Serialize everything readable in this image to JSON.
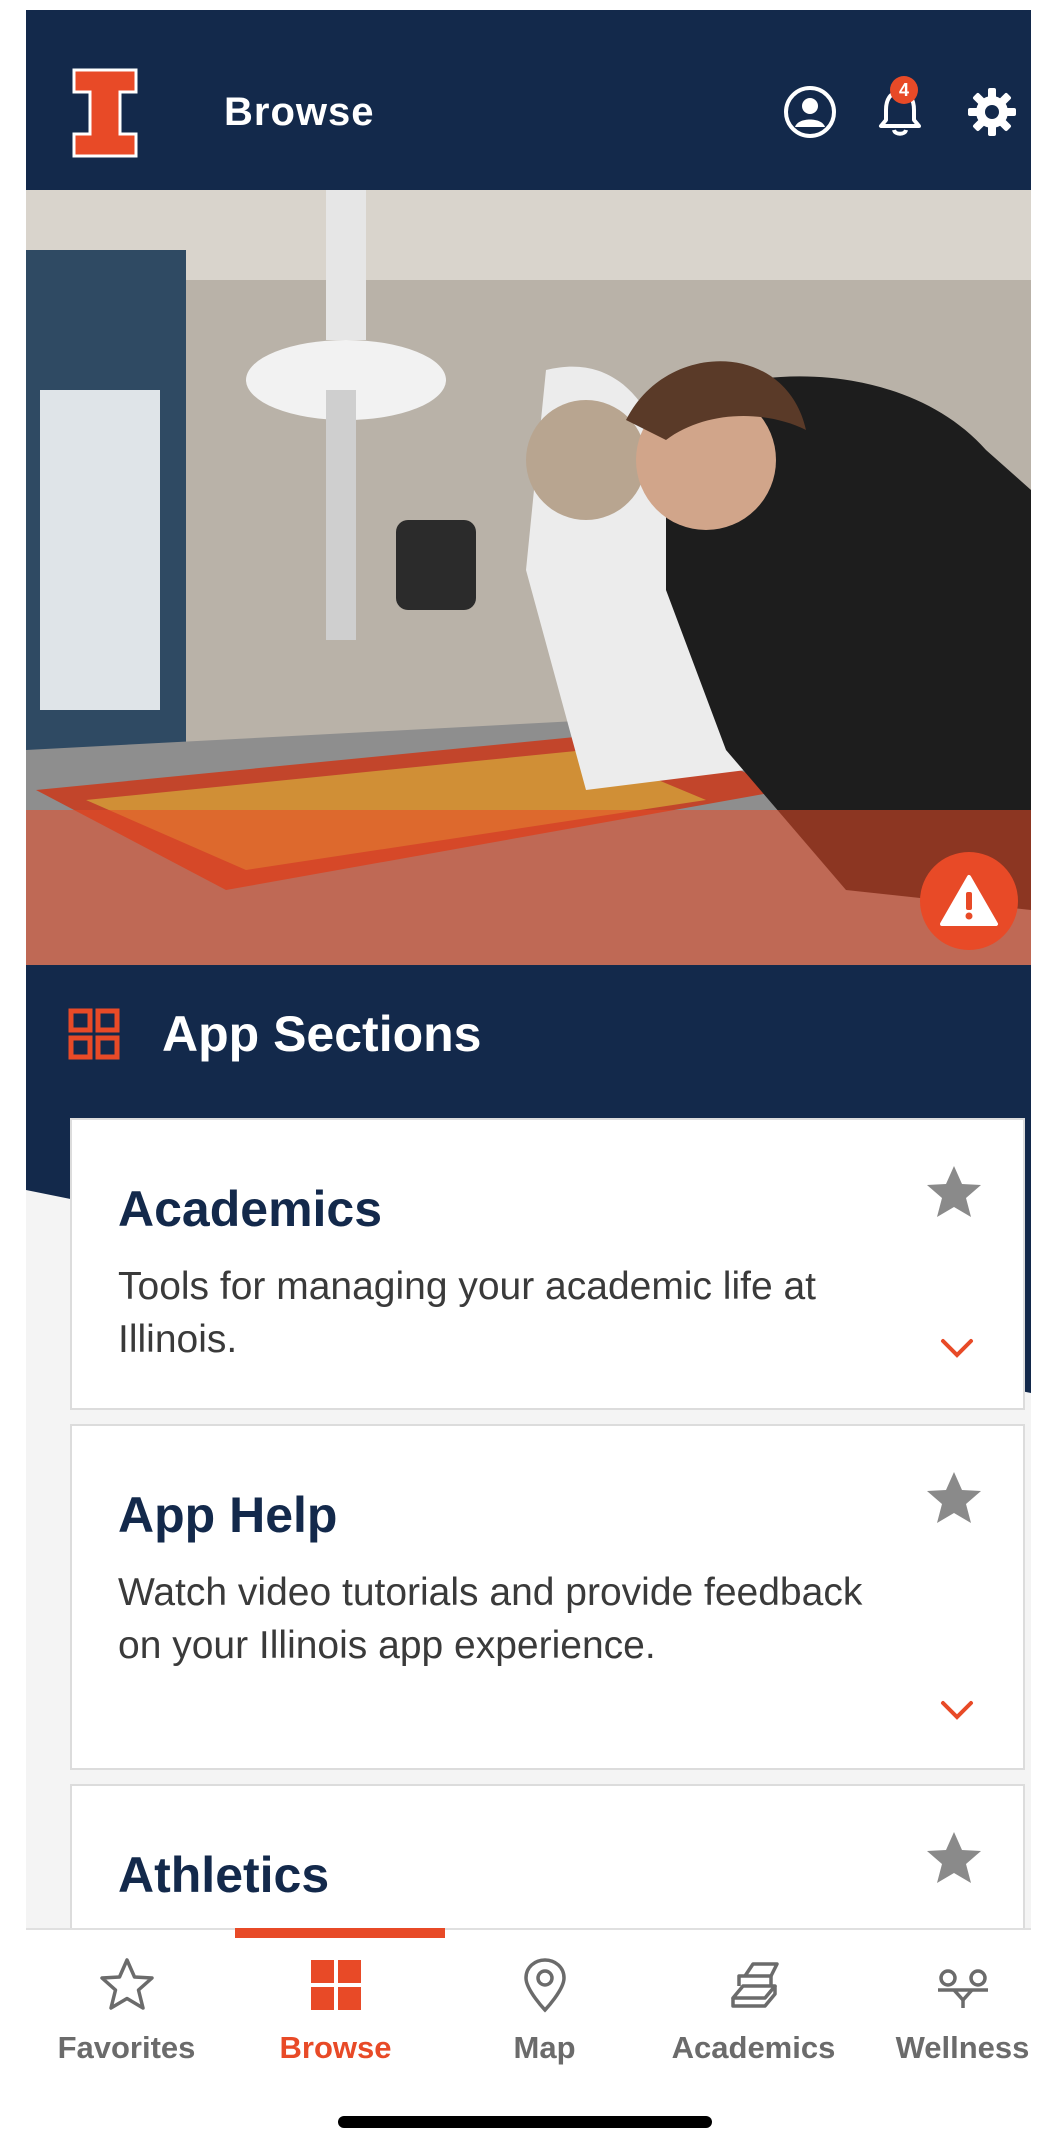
{
  "header": {
    "title": "Browse",
    "notification_count": "4",
    "icons": [
      "illinois-logo",
      "profile-icon",
      "bell-icon",
      "gear-icon"
    ]
  },
  "hero": {
    "alert_icon": "warning-icon"
  },
  "sections": {
    "title": "App Sections",
    "icon": "grid-icon"
  },
  "cards": [
    {
      "title": "Academics",
      "description": "Tools for managing your academic life at Illinois."
    },
    {
      "title": "App Help",
      "description": "Watch video tutorials and provide feedback on your Illinois app experience."
    },
    {
      "title": "Athletics",
      "description": ""
    }
  ],
  "bottom_nav": {
    "active": "Browse",
    "items": [
      {
        "label": "Favorites",
        "icon": "star-outline-icon"
      },
      {
        "label": "Browse",
        "icon": "grid-icon"
      },
      {
        "label": "Map",
        "icon": "map-pin-icon"
      },
      {
        "label": "Academics",
        "icon": "book-stack-icon"
      },
      {
        "label": "Wellness",
        "icon": "wellness-icon"
      }
    ]
  },
  "colors": {
    "navy": "#13294b",
    "orange": "#e84a27",
    "gray_text": "#6b6b6b"
  }
}
